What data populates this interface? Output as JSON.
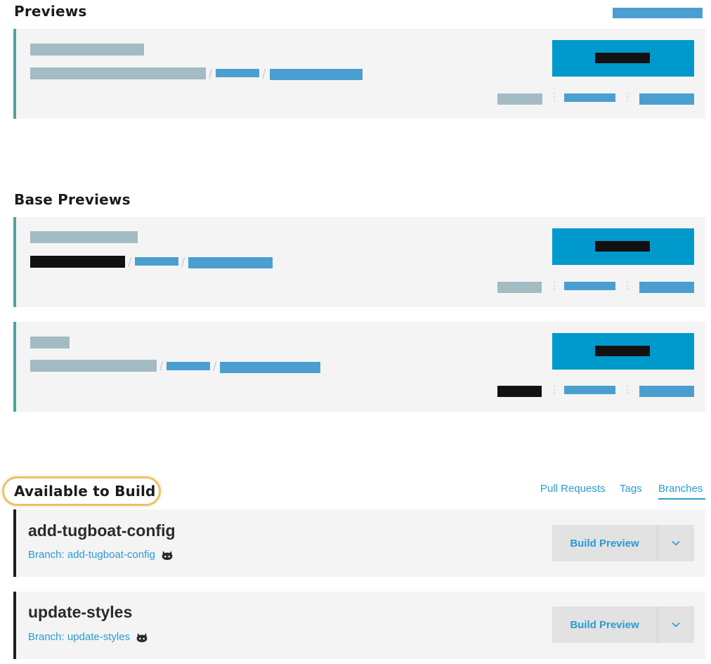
{
  "sections": {
    "previews_title": "Previews",
    "base_previews_title": "Base Previews",
    "available_title": "Available to Build"
  },
  "filter_tabs": [
    {
      "label": "Pull Requests",
      "active": false
    },
    {
      "label": "Tags",
      "active": false
    },
    {
      "label": "Branches",
      "active": true
    }
  ],
  "available": [
    {
      "name": "add-tugboat-config",
      "branch_label": "Branch: add-tugboat-config",
      "icon": "github-icon",
      "button": "Build Preview"
    },
    {
      "name": "update-styles",
      "branch_label": "Branch: update-styles",
      "icon": "github-icon",
      "button": "Build Preview"
    }
  ],
  "colors": {
    "accent": "#2a9bd0",
    "primary_button": "#0099cc",
    "teal_border": "#4aa59d",
    "redaction_grey": "#a3bbc3",
    "redaction_blue": "#4a9fd0"
  }
}
